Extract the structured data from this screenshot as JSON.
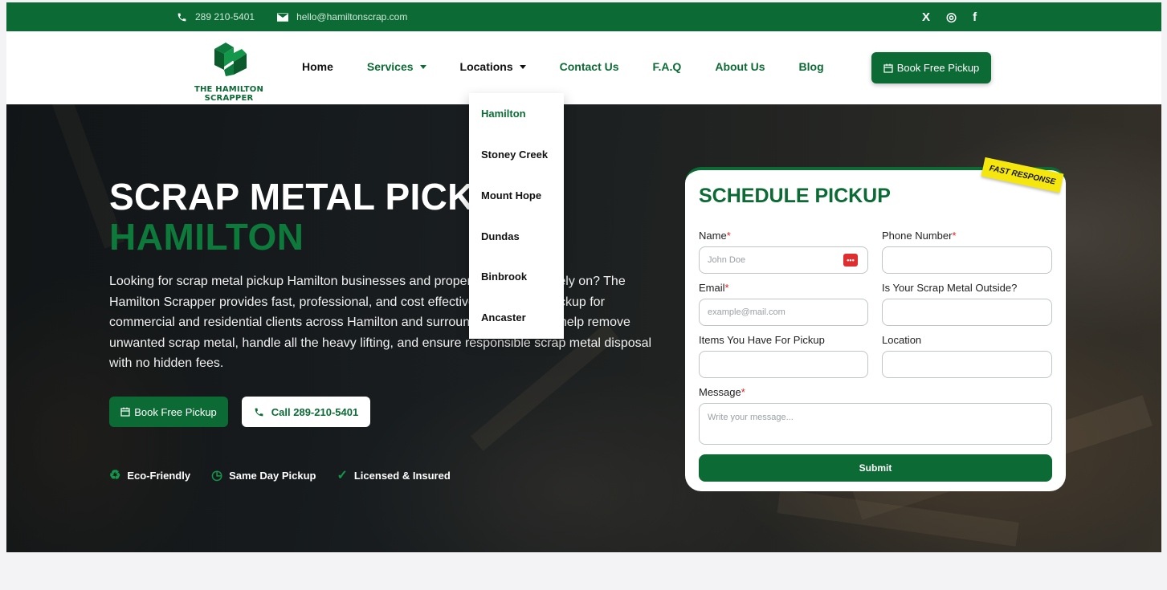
{
  "colors": {
    "brand_green": "#0c6b35",
    "accent_green": "#0d7a3c",
    "ribbon_yellow": "#f5e70e",
    "required_red": "#d22222"
  },
  "topbar": {
    "phone": "289 210-5401",
    "email": "hello@hamiltonscrap.com",
    "phone_icon": "phone-icon",
    "email_icon": "envelope-icon",
    "social": {
      "x": "X",
      "instagram": "◎",
      "facebook": "f"
    }
  },
  "logo": {
    "text": "THE HAMILTON SCRAPPER"
  },
  "nav": {
    "items": [
      {
        "label": "Home",
        "has_caret": false,
        "style": "dark"
      },
      {
        "label": "Services",
        "has_caret": true,
        "style": "green"
      },
      {
        "label": "Locations",
        "has_caret": true,
        "style": "dark"
      },
      {
        "label": "Contact Us",
        "has_caret": false,
        "style": "green"
      },
      {
        "label": "F.A.Q",
        "has_caret": false,
        "style": "green"
      },
      {
        "label": "About Us",
        "has_caret": false,
        "style": "green"
      },
      {
        "label": "Blog",
        "has_caret": false,
        "style": "green"
      }
    ],
    "cta": "Book Free Pickup"
  },
  "locations_dropdown": {
    "items": [
      "Hamilton",
      "Stoney Creek",
      "Mount Hope",
      "Dundas",
      "Binbrook",
      "Ancaster"
    ],
    "active_index": 0
  },
  "hero": {
    "title_line1": "SCRAP METAL PICKUP",
    "title_line2": "HAMILTON",
    "lead": "Looking for scrap metal pickup Hamilton businesses and property owners can rely on? The Hamilton Scrapper provides fast, professional, and cost effective scrap metal pickup for commercial and residential clients across Hamilton and surrounding areas. We help remove unwanted scrap metal, handle all the heavy lifting, and ensure responsible scrap metal disposal with no hidden fees.",
    "btn_book": "Book Free Pickup",
    "btn_call": "Call 289-210-5401",
    "features": [
      "Eco-Friendly",
      "Same Day Pickup",
      "Licensed & Insured"
    ]
  },
  "form": {
    "title": "SCHEDULE PICKUP",
    "ribbon": "FAST RESPONSE",
    "name_label": "Name",
    "name_placeholder": "John Doe",
    "phone_label": "Phone Number",
    "email_label": "Email",
    "email_placeholder": "example@mail.com",
    "outside_label": "Is Your Scrap Metal Outside?",
    "items_label": "Items You Have For Pickup",
    "location_label": "Location",
    "message_label": "Message",
    "message_placeholder": "Write your message...",
    "submit": "Submit",
    "required_mark": "*"
  }
}
